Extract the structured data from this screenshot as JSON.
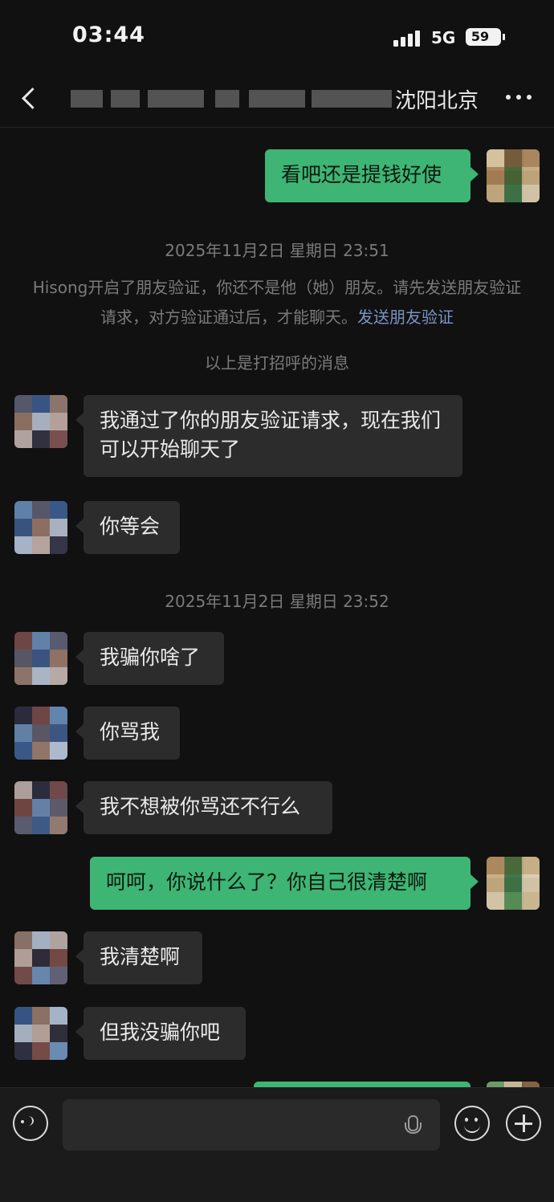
{
  "status_bar": {
    "time": "03:44",
    "network": "5G",
    "battery": "59"
  },
  "header": {
    "title_visible": "沈阳北京",
    "back_icon": "chevron-left-icon",
    "more_icon": "more-dots-icon"
  },
  "messages": [
    {
      "type": "mine",
      "text": "看吧还是提钱好使"
    },
    {
      "type": "timestamp",
      "text": "2025年11月2日 星期日 23:51"
    },
    {
      "type": "system",
      "text": "Hisong开启了朋友验证，你还不是他（她）朋友。请先发送朋友验证请求，对方验证通过后，才能聊天。",
      "link": "发送朋友验证"
    },
    {
      "type": "system_plain",
      "text": "以上是打招呼的消息"
    },
    {
      "type": "other",
      "text": "我通过了你的朋友验证请求，现在我们可以开始聊天了"
    },
    {
      "type": "other",
      "text": "你等会"
    },
    {
      "type": "timestamp",
      "text": "2025年11月2日 星期日 23:52"
    },
    {
      "type": "other",
      "text": "我骗你啥了"
    },
    {
      "type": "other",
      "text": "你骂我"
    },
    {
      "type": "other",
      "text": "我不想被你骂还不行么"
    },
    {
      "type": "mine",
      "text": "呵呵，你说什么了？你自己很清楚啊"
    },
    {
      "type": "other",
      "text": "我清楚啊"
    },
    {
      "type": "other",
      "text": "但我没骗你吧"
    },
    {
      "type": "mine",
      "text": ""
    }
  ],
  "input_bar": {
    "voice_icon": "voice-icon",
    "mic_icon": "microphone-icon",
    "emoji_icon": "emoji-icon",
    "plus_icon": "plus-icon",
    "input_value": ""
  },
  "colors": {
    "background": "#111111",
    "mine_bubble": "#3eb575",
    "other_bubble": "#2c2c2c",
    "link": "#7a93c4"
  }
}
